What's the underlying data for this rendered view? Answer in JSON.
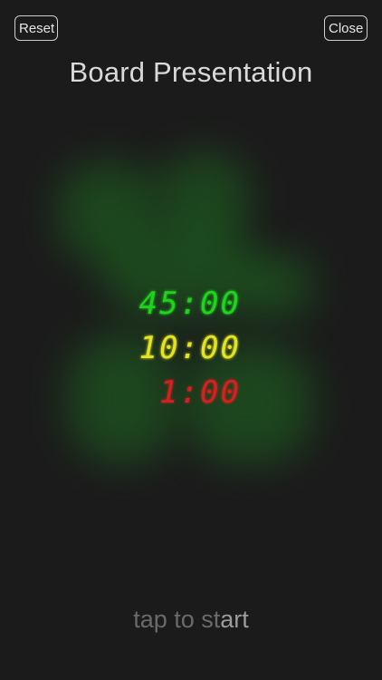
{
  "header": {
    "reset_label": "Reset",
    "close_label": "Close",
    "title": "Board Presentation"
  },
  "timers": [
    {
      "value": "45:00",
      "color": "#1fd31f"
    },
    {
      "value": "10:00",
      "color": "#e3e321"
    },
    {
      "value": "1:00",
      "color": "#d42020"
    }
  ],
  "footer": {
    "hint_prefix": "tap to st",
    "hint_suffix": "art"
  },
  "colors": {
    "background": "#1b1b1b",
    "glow": "#1f7a22"
  }
}
